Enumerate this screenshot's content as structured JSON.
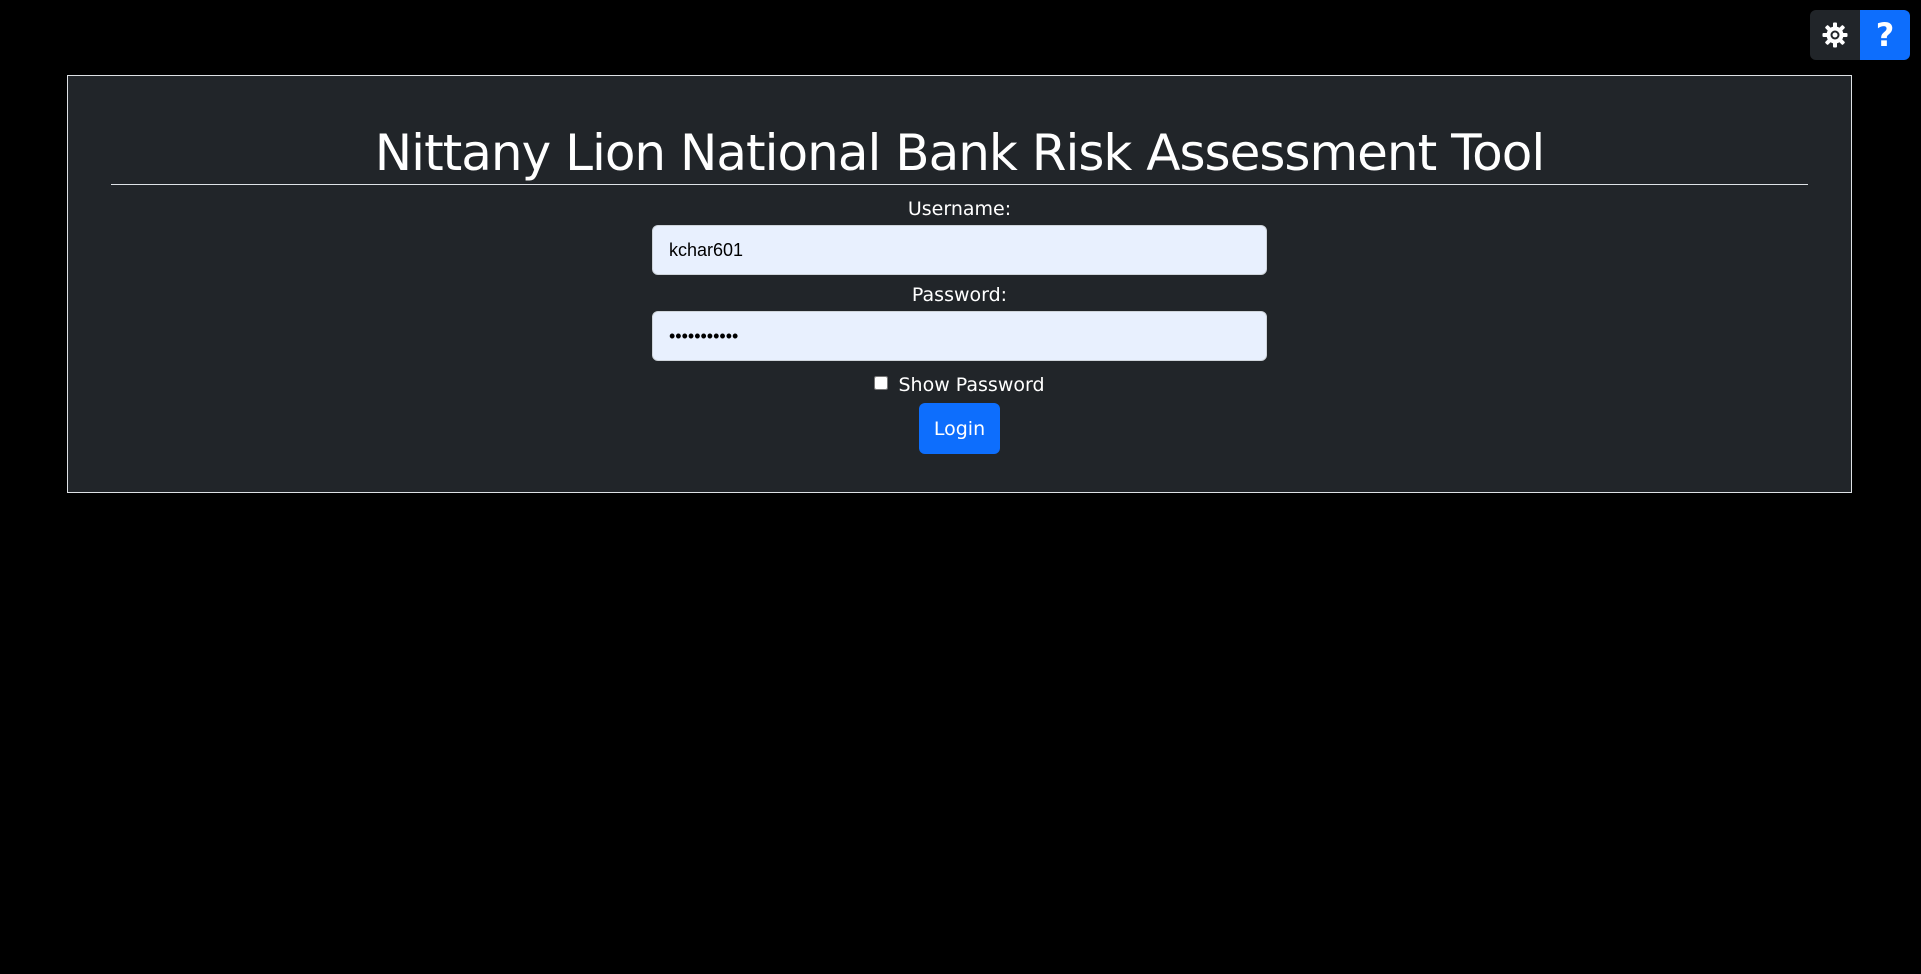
{
  "toolbar": {
    "theme_icon": "gear-icon",
    "help_label": "?",
    "help_color": "#0d6efd"
  },
  "header": {
    "title": "Nittany Lion National Bank Risk Assessment Tool"
  },
  "login_form": {
    "username_label": "Username:",
    "username_value": "kchar601",
    "password_label": "Password:",
    "password_value": "kchar601pwd",
    "show_password_label": "Show Password",
    "show_password_checked": false,
    "login_label": "Login"
  },
  "colors": {
    "background": "#000000",
    "panel": "#212529",
    "accent": "#0d6efd",
    "input_bg": "#e8f0fe"
  }
}
